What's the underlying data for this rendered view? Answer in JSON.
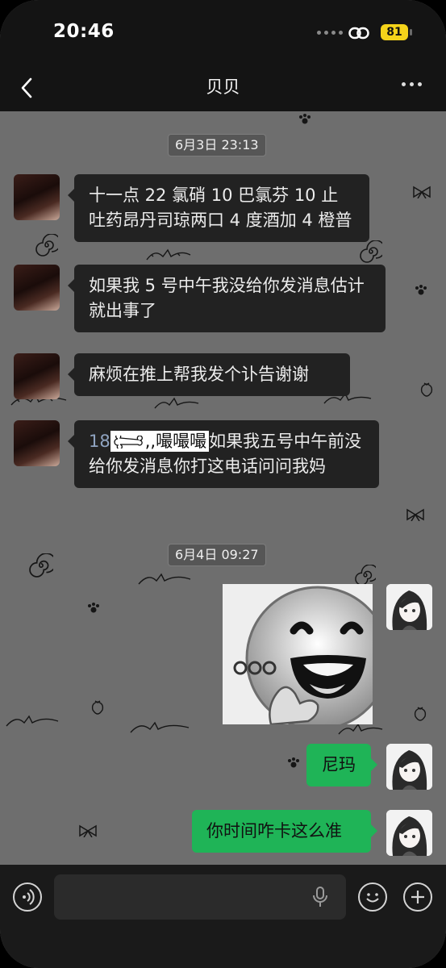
{
  "status_bar": {
    "time": "20:46",
    "battery": "81"
  },
  "header": {
    "title": "贝贝"
  },
  "timestamps": {
    "first": "6月3日 23:13",
    "second": "6月4日 09:27"
  },
  "messages": {
    "m1": "十一点 22 氯硝 10 巴氯芬 10 止吐药昂丹司琼两口 4 度酒加 4 橙普",
    "m2": "如果我 5 号中午我没给你发消息估计就出事了",
    "m3": "麻烦在推上帮我发个讣告谢谢",
    "m4_prefix": "18",
    "m4_sticker": ",,嘬嘬嘬",
    "m4_text": "如果我五号中午前没给你发消息你打这电话问问我妈",
    "m6": "尼玛",
    "m7": "你时间咋卡这么准"
  },
  "colors": {
    "chat_bg": "#6e6e6e",
    "incoming": "#222222",
    "outgoing": "#1fb457",
    "battery": "#f4d31a"
  },
  "icons": [
    "back-icon",
    "more-icon",
    "link-icon",
    "voice-toggle-icon",
    "microphone-icon",
    "emoji-icon",
    "plus-icon",
    "bone-icon"
  ]
}
